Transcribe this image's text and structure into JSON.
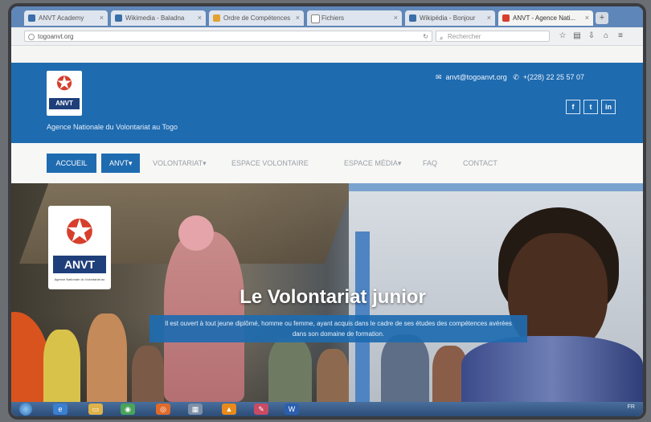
{
  "browser": {
    "tabs": [
      {
        "label": "ANVT Academy"
      },
      {
        "label": "Wikimedia - Baladna"
      },
      {
        "label": "Ordre de Compétences"
      },
      {
        "label": "Fichiers"
      },
      {
        "label": "Wikipédia - Bonjour"
      },
      {
        "label": "ANVT - Agence Nati..."
      }
    ],
    "url": "togoanvt.org",
    "search_placeholder": "Rechercher",
    "icons": [
      "star-icon",
      "reader-icon",
      "download-icon",
      "home-icon",
      "menu-icon"
    ]
  },
  "header": {
    "logo_text": "ANVT",
    "tagline": "Agence Nationale du Volontariat au Togo",
    "email": "anvt@togoanvt.org",
    "phone": "+(228) 22 25 57 07",
    "social": [
      "f",
      "t",
      "in"
    ],
    "colors": {
      "brand_blue": "#1e6bb0"
    }
  },
  "menu": {
    "items": [
      "ACCUEIL",
      "ANVT▾",
      "VOLONTARIAT▾",
      "ESPACE VOLONTAIRE",
      "ESPACE MÉDIA▾",
      "FAQ",
      "CONTACT"
    ]
  },
  "hero": {
    "logo_text": "ANVT",
    "logo_subtitle": "Agence Nationale du Volontariat au Togo",
    "title": "Le Volontariat junior",
    "description": "Il est ouvert à tout jeune diplômé, homme ou femme, ayant acquis dans le cadre de ses études des compétences avérées dans son domaine de formation."
  },
  "taskbar": {
    "apps": [
      "start-icon",
      "ie-icon",
      "folder-icon",
      "chrome-icon",
      "firefox-icon",
      "explorer-icon",
      "vlc-icon",
      "paint-icon",
      "word-icon"
    ],
    "clock": "FR"
  }
}
